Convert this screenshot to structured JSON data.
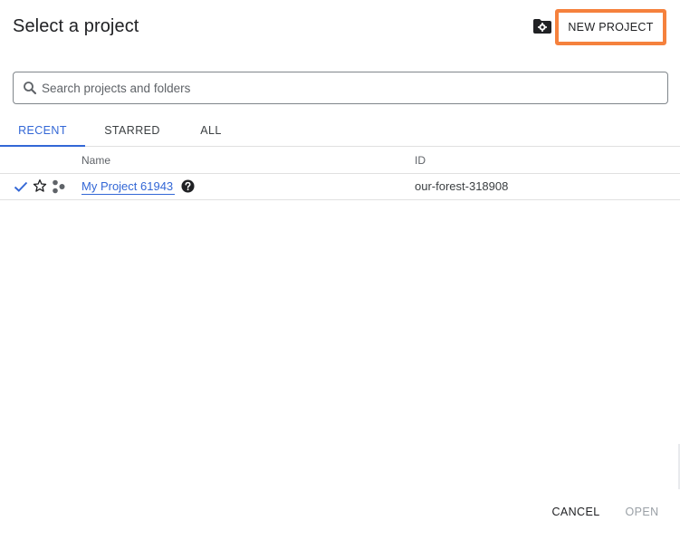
{
  "dialog": {
    "title": "Select a project",
    "new_project_label": "NEW PROJECT"
  },
  "search": {
    "placeholder": "Search projects and folders",
    "value": ""
  },
  "tabs": [
    {
      "label": "RECENT",
      "active": true
    },
    {
      "label": "STARRED",
      "active": false
    },
    {
      "label": "ALL",
      "active": false
    }
  ],
  "table": {
    "columns": [
      "Name",
      "ID"
    ],
    "rows": [
      {
        "selected": true,
        "starred": false,
        "name": "My Project 61943",
        "id": "our-forest-318908"
      }
    ]
  },
  "footer": {
    "cancel_label": "CANCEL",
    "open_label": "OPEN"
  },
  "colors": {
    "accent": "#3367d6",
    "highlight": "#f5813d",
    "disabled": "#9aa0a6"
  },
  "icons": {
    "manage_resources": "folder-gear-icon",
    "search": "search-icon",
    "selected": "check-icon",
    "star": "star-outline-icon",
    "project_type": "project-nodes-icon",
    "help": "help-circle-icon"
  }
}
